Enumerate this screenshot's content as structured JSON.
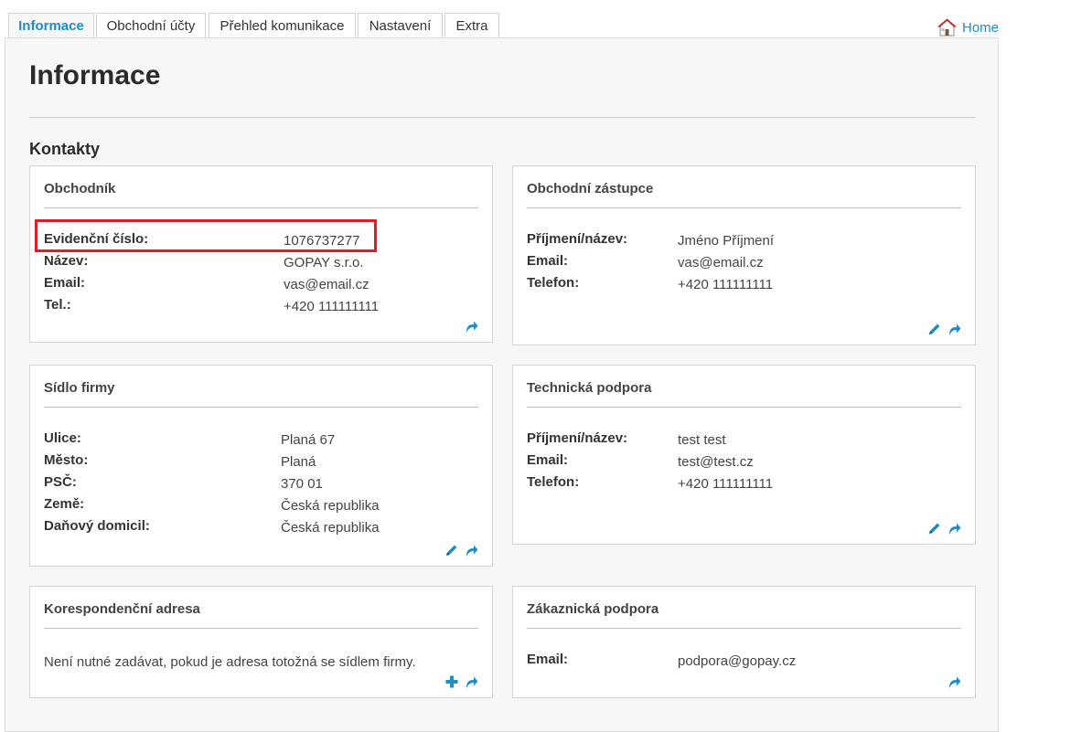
{
  "tabs": [
    {
      "label": "Informace",
      "active": true
    },
    {
      "label": "Obchodní účty",
      "active": false
    },
    {
      "label": "Přehled komunikace",
      "active": false
    },
    {
      "label": "Nastavení",
      "active": false
    },
    {
      "label": "Extra",
      "active": false
    }
  ],
  "home": {
    "label": "Home",
    "icon": "home-icon"
  },
  "page": {
    "title": "Informace",
    "section": "Kontakty"
  },
  "colors": {
    "accent": "#1f8ec6",
    "highlight": "#e01b24",
    "panel_bg": "#f7f7f7"
  },
  "cards": {
    "obchodnik": {
      "title": "Obchodník",
      "rows": [
        {
          "label": "Evidenční číslo:",
          "value": "1076737277"
        },
        {
          "label": "Název:",
          "value": "GOPAY s.r.o."
        },
        {
          "label": "Email:",
          "value": "vas@email.cz"
        },
        {
          "label": "Tel.:",
          "value": "+420 111111111"
        }
      ]
    },
    "zastupce": {
      "title": "Obchodní zástupce",
      "rows": [
        {
          "label": "Příjmení/název:",
          "value": "Jméno Příjmení"
        },
        {
          "label": "Email:",
          "value": "vas@email.cz"
        },
        {
          "label": "Telefon:",
          "value": "+420 111111111"
        }
      ]
    },
    "sidlo": {
      "title": "Sídlo firmy",
      "rows": [
        {
          "label": "Ulice:",
          "value": "Planá 67"
        },
        {
          "label": "Město:",
          "value": "Planá"
        },
        {
          "label": "PSČ:",
          "value": "370 01"
        },
        {
          "label": "Země:",
          "value": "Česká republika"
        },
        {
          "label": "Daňový domicil:",
          "value": "Česká republika"
        }
      ]
    },
    "technicka": {
      "title": "Technická podpora",
      "rows": [
        {
          "label": "Příjmení/název:",
          "value": "test test"
        },
        {
          "label": "Email:",
          "value": "test@test.cz"
        },
        {
          "label": "Telefon:",
          "value": "+420 111111111"
        }
      ]
    },
    "korespondencni": {
      "title": "Korespondenční adresa",
      "note": "Není nutné zadávat, pokud je adresa totožná se sídlem firmy."
    },
    "zakaznicka": {
      "title": "Zákaznická podpora",
      "rows": [
        {
          "label": "Email:",
          "value": "podpora@gopay.cz"
        }
      ]
    }
  }
}
